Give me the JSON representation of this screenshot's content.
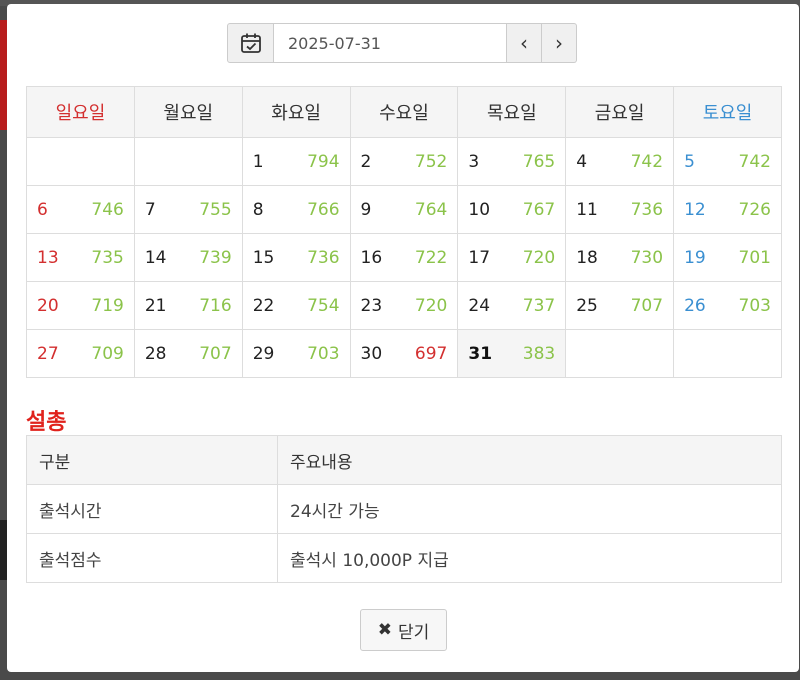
{
  "toolbar": {
    "calendar_icon": "calendar-check-icon",
    "date_value": "2025-07-31",
    "prev_glyph": "‹",
    "next_glyph": "›"
  },
  "calendar": {
    "weekdays": [
      "일요일",
      "월요일",
      "화요일",
      "수요일",
      "목요일",
      "금요일",
      "토요일"
    ],
    "weeks": [
      [
        {
          "day": "",
          "count": ""
        },
        {
          "day": "",
          "count": ""
        },
        {
          "day": "1",
          "count": "794"
        },
        {
          "day": "2",
          "count": "752"
        },
        {
          "day": "3",
          "count": "765"
        },
        {
          "day": "4",
          "count": "742"
        },
        {
          "day": "5",
          "count": "742"
        }
      ],
      [
        {
          "day": "6",
          "count": "746"
        },
        {
          "day": "7",
          "count": "755"
        },
        {
          "day": "8",
          "count": "766"
        },
        {
          "day": "9",
          "count": "764"
        },
        {
          "day": "10",
          "count": "767"
        },
        {
          "day": "11",
          "count": "736"
        },
        {
          "day": "12",
          "count": "726"
        }
      ],
      [
        {
          "day": "13",
          "count": "735"
        },
        {
          "day": "14",
          "count": "739"
        },
        {
          "day": "15",
          "count": "736"
        },
        {
          "day": "16",
          "count": "722"
        },
        {
          "day": "17",
          "count": "720"
        },
        {
          "day": "18",
          "count": "730"
        },
        {
          "day": "19",
          "count": "701"
        }
      ],
      [
        {
          "day": "20",
          "count": "719"
        },
        {
          "day": "21",
          "count": "716"
        },
        {
          "day": "22",
          "count": "754"
        },
        {
          "day": "23",
          "count": "720"
        },
        {
          "day": "24",
          "count": "737"
        },
        {
          "day": "25",
          "count": "707"
        },
        {
          "day": "26",
          "count": "703"
        }
      ],
      [
        {
          "day": "27",
          "count": "709"
        },
        {
          "day": "28",
          "count": "707"
        },
        {
          "day": "29",
          "count": "703"
        },
        {
          "day": "30",
          "count": "697",
          "low": true
        },
        {
          "day": "31",
          "count": "383",
          "today": true
        },
        {
          "day": "",
          "count": ""
        },
        {
          "day": "",
          "count": ""
        }
      ]
    ]
  },
  "settings": {
    "title": "설총",
    "headers": [
      "구분",
      "주요내용"
    ],
    "rows": [
      {
        "label": "출석시간",
        "value": "24시간 가능"
      },
      {
        "label": "출석점수",
        "value": "출석시 10,000P 지급"
      }
    ]
  },
  "footer": {
    "close_icon": "close-x-icon",
    "close_label": "닫기"
  },
  "colors": {
    "sunday": "#d32f2f",
    "saturday": "#3a8fd1",
    "count": "#8bc34a",
    "low_count": "#d32f2f",
    "section_title": "#e0221c"
  }
}
